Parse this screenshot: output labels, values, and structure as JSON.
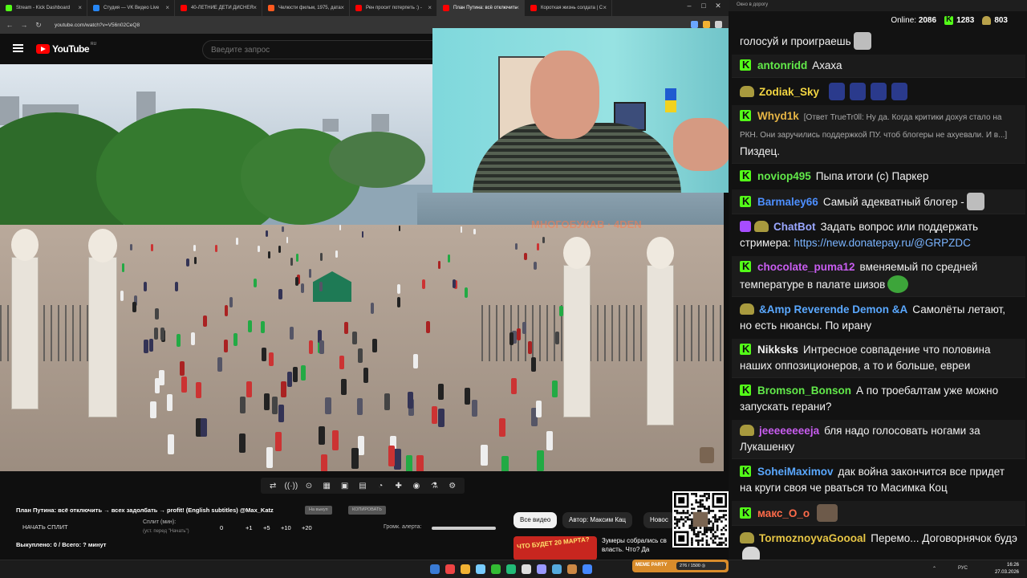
{
  "browser": {
    "tabs": [
      {
        "title": "Stream - Kick Dashboard",
        "color": "#53fc18"
      },
      {
        "title": "Студия — VK Видео Live",
        "color": "#2787f5"
      },
      {
        "title": "40-ЛЕТНИЕ ДЕТИ ДИСНЕЯ",
        "color": "#ff0000"
      },
      {
        "title": "Челюсти фильм, 1975, дата",
        "color": "#ff5a1f"
      },
      {
        "title": "Рен просит потерпеть :) -",
        "color": "#ff0000"
      },
      {
        "title": "План Путина: всё отключить",
        "color": "#ff0000",
        "active": true
      },
      {
        "title": "Короткая жизнь солдата | С",
        "color": "#ff0000"
      }
    ],
    "url": "youtube.com/watch?v=V56n02CeQ8",
    "icons": {
      "back": "←",
      "forward": "→",
      "reload": "↻",
      "minimize": "–",
      "maximize": "□",
      "close": "✕",
      "tab_close": "×"
    }
  },
  "youtube": {
    "logo": "YouTube",
    "region": "RU",
    "search_placeholder": "Введите запрос"
  },
  "video": {
    "watermark": "МНОГОБУКАВ · 4DEN"
  },
  "controls": [
    "⇄",
    "((·))",
    "⊙",
    "▦",
    "▣",
    "▤",
    "◔",
    "✚",
    "◉",
    "⚗",
    "⚙"
  ],
  "stream_panel": {
    "title": "План Путина: всё отключить → всех задолбать → profit! (English subtitles) @Max_Katz",
    "pill1": "На выкуп",
    "pill2": "КОПИРОВАТЬ",
    "start_split": "НАЧАТЬ СПЛИТ",
    "split_label": "Сплит (мин):",
    "split_hint": "(уст. перед \"Начать\")",
    "split_value": "0",
    "increments": [
      "+1",
      "+5",
      "+10",
      "+20"
    ],
    "alert_label": "Громк. алерта:",
    "summary": "Выкуплено: 0 / Всего: ? минут"
  },
  "recommendations": {
    "chips": [
      "Все видео",
      "Автор: Максим Кац",
      "Новос"
    ],
    "thumb_text": "ЧТО БУДЕТ 20 МАРТА?",
    "title": "Зумеры собрались св власть. Что? Да"
  },
  "taskbar": {
    "meme_label": "MEME PARTY",
    "meme_progress": "276 / 1500 ◎",
    "lang": "РУС",
    "time": "16:26",
    "date": "27.03.2026",
    "tray_arrow": "⌃"
  },
  "chat": {
    "window_title": "Окно в дорогу",
    "online_label": "Online:",
    "online": "2086",
    "kick_count": "1283",
    "other_count": "803",
    "messages": [
      {
        "badge": "none",
        "user": "",
        "color": "#fff",
        "text": "голосуй и проиграешь",
        "emotes": [
          "face"
        ]
      },
      {
        "badge": "k",
        "user": "antonridd",
        "color": "#62e94a",
        "text": "Ахаха"
      },
      {
        "badge": "pepe",
        "user": "Zodiak_Sky",
        "color": "#f2d542",
        "text": "",
        "emotes": [
          "suit",
          "suit",
          "suit",
          "suit"
        ]
      },
      {
        "badge": "k",
        "user": "Whyd1k",
        "color": "#e6b545",
        "reply": "[Ответ TrueTr0ll: Ну да. Когда критики дохуя стало на РКН. Они заручились поддержкой ПУ. чтоб блогеры не ахуевали. И в...]",
        "text": "Пиздец."
      },
      {
        "badge": "k",
        "user": "noviop495",
        "color": "#62e94a",
        "text": "Пыпа итоги (с) Паркер"
      },
      {
        "badge": "k",
        "user": "Barmaley66",
        "color": "#4d8fff",
        "text": "Самый адекватный блогер -",
        "emotes": [
          "face"
        ]
      },
      {
        "badge": "bot",
        "user": "ChatBot",
        "color": "#9aa7ff",
        "text": "Задать вопрос или поддержать стримера:",
        "link": "https://new.donatepay.ru/@GRPZDC"
      },
      {
        "badge": "k",
        "user": "chocolate_puma12",
        "color": "#c85df0",
        "text": "вменяемый по средней температуре в палате шизов",
        "emotes": [
          "pepe"
        ]
      },
      {
        "badge": "pepe",
        "user": "&Amp Reverende Demon &A",
        "color": "#5aa8ff",
        "text": "Самолёты летают, но есть нюансы. По ирану"
      },
      {
        "badge": "k",
        "user": "Nikksks",
        "color": "#f0f0f0",
        "text": "Интресное совпадение что половина наших оппозиционеров, а то и больше, евреи"
      },
      {
        "badge": "k",
        "user": "Bromson_Bonson",
        "color": "#62e94a",
        "text": "А по троебалтам уже можно запускать герани?"
      },
      {
        "badge": "pepe",
        "user": "jeeeeeeeeja",
        "color": "#c85df0",
        "text": "бля надо голосовать ногами за Лукашенку"
      },
      {
        "badge": "k",
        "user": "SoheiMaximov",
        "color": "#5aa8ff",
        "text": "дак война закончится все придет на круги своя че рваться то Масимка Коц"
      },
      {
        "badge": "k",
        "user": "макс_O_o",
        "color": "#ff6b4a",
        "text": "",
        "emotes": [
          "photo"
        ]
      },
      {
        "badge": "pepe",
        "user": "TormoznoyvaGoooal",
        "color": "#e6c545",
        "text": "Перемо... Договорнячок будэ",
        "emotes": [
          "cat"
        ]
      }
    ]
  }
}
